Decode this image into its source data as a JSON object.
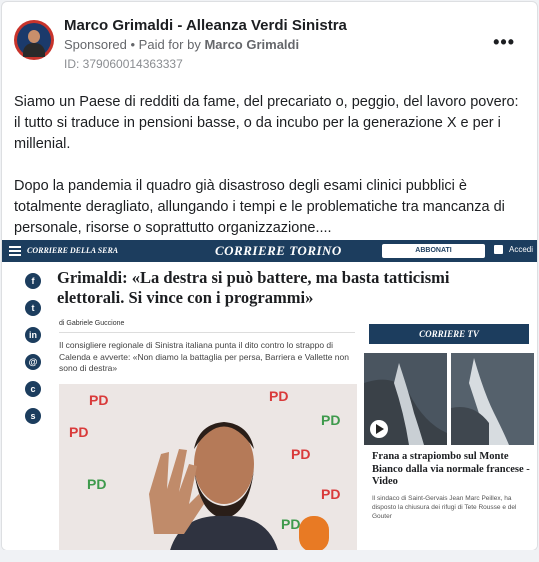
{
  "post": {
    "author": "Marco Grimaldi - Alleanza Verdi Sinistra",
    "sponsored": "Sponsored",
    "paid_prefix": "• Paid for by",
    "paid_by": "Marco Grimaldi",
    "ad_id": "ID: 379060014363337",
    "more_icon": "more-options-icon",
    "paragraph1": "Siamo un Paese di redditi da fame, del precariato o, peggio, del lavoro povero: il tutto si traduce in pensioni basse, o da incubo per la generazione X e per i millenial.",
    "paragraph2": "Dopo la pandemia il quadro già disastroso degli esami clinici pubblici è totalmente deragliato, allungando i tempi e le problematiche tra mancanza di personale, risorse o soprattutto organizzazione...."
  },
  "article": {
    "brand": "CORRIERE DELLA SERA",
    "edition": "CORRIERE TORINO",
    "subscribe": "ABBONATI",
    "login": "Accedi",
    "social_icons": [
      "f",
      "t",
      "in",
      "@",
      "c",
      "s"
    ],
    "title": "Grimaldi: «La destra si può battere, ma basta tatticismi elettorali. Si vince con i programmi»",
    "author_line": "di Gabriele Guccione",
    "lead": "Il consigliere regionale di Sinistra italiana punta il dito contro lo strappo di Calenda e avverte: «Non diamo la battaglia per persa, Barriera e Vallette non sono di destra»",
    "tv_label": "CORRIERE TV",
    "tv_title": "Frana a strapiombo sul Monte Bianco dalla via normale francese - Video",
    "tv_sub": "Il sindaco di Saint-Gervais Jean Marc Peillex, ha disposto la chiusura dei rifugi di Tete Rousse e del Gouter"
  },
  "colors": {
    "corriere_navy": "#1c3d5e",
    "text": "#1c1e21",
    "muted": "#65676b"
  }
}
